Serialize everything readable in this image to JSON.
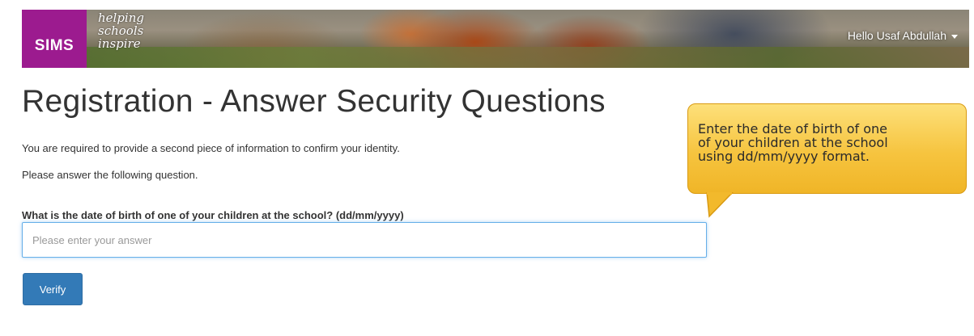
{
  "header": {
    "logo_text": "SIMS",
    "tagline": [
      "helping",
      "schools",
      "inspire"
    ],
    "user_greeting": "Hello Usaf Abdullah",
    "brand_color": "#9c1b8f"
  },
  "main": {
    "title": "Registration - Answer Security Questions",
    "intro": "You are required to provide a second piece of information to confirm your identity.",
    "instruction": "Please answer the following question.",
    "question": "What is the date of birth of one of your children at the school? (dd/mm/yyyy)",
    "answer_value": "",
    "answer_placeholder": "Please enter your answer",
    "verify_label": "Verify",
    "button_color": "#337ab7"
  },
  "callout": {
    "lines": [
      "Enter the date of birth of one",
      "of your children at the school",
      "using dd/mm/yyyy format."
    ],
    "color": "#f6c43f"
  }
}
